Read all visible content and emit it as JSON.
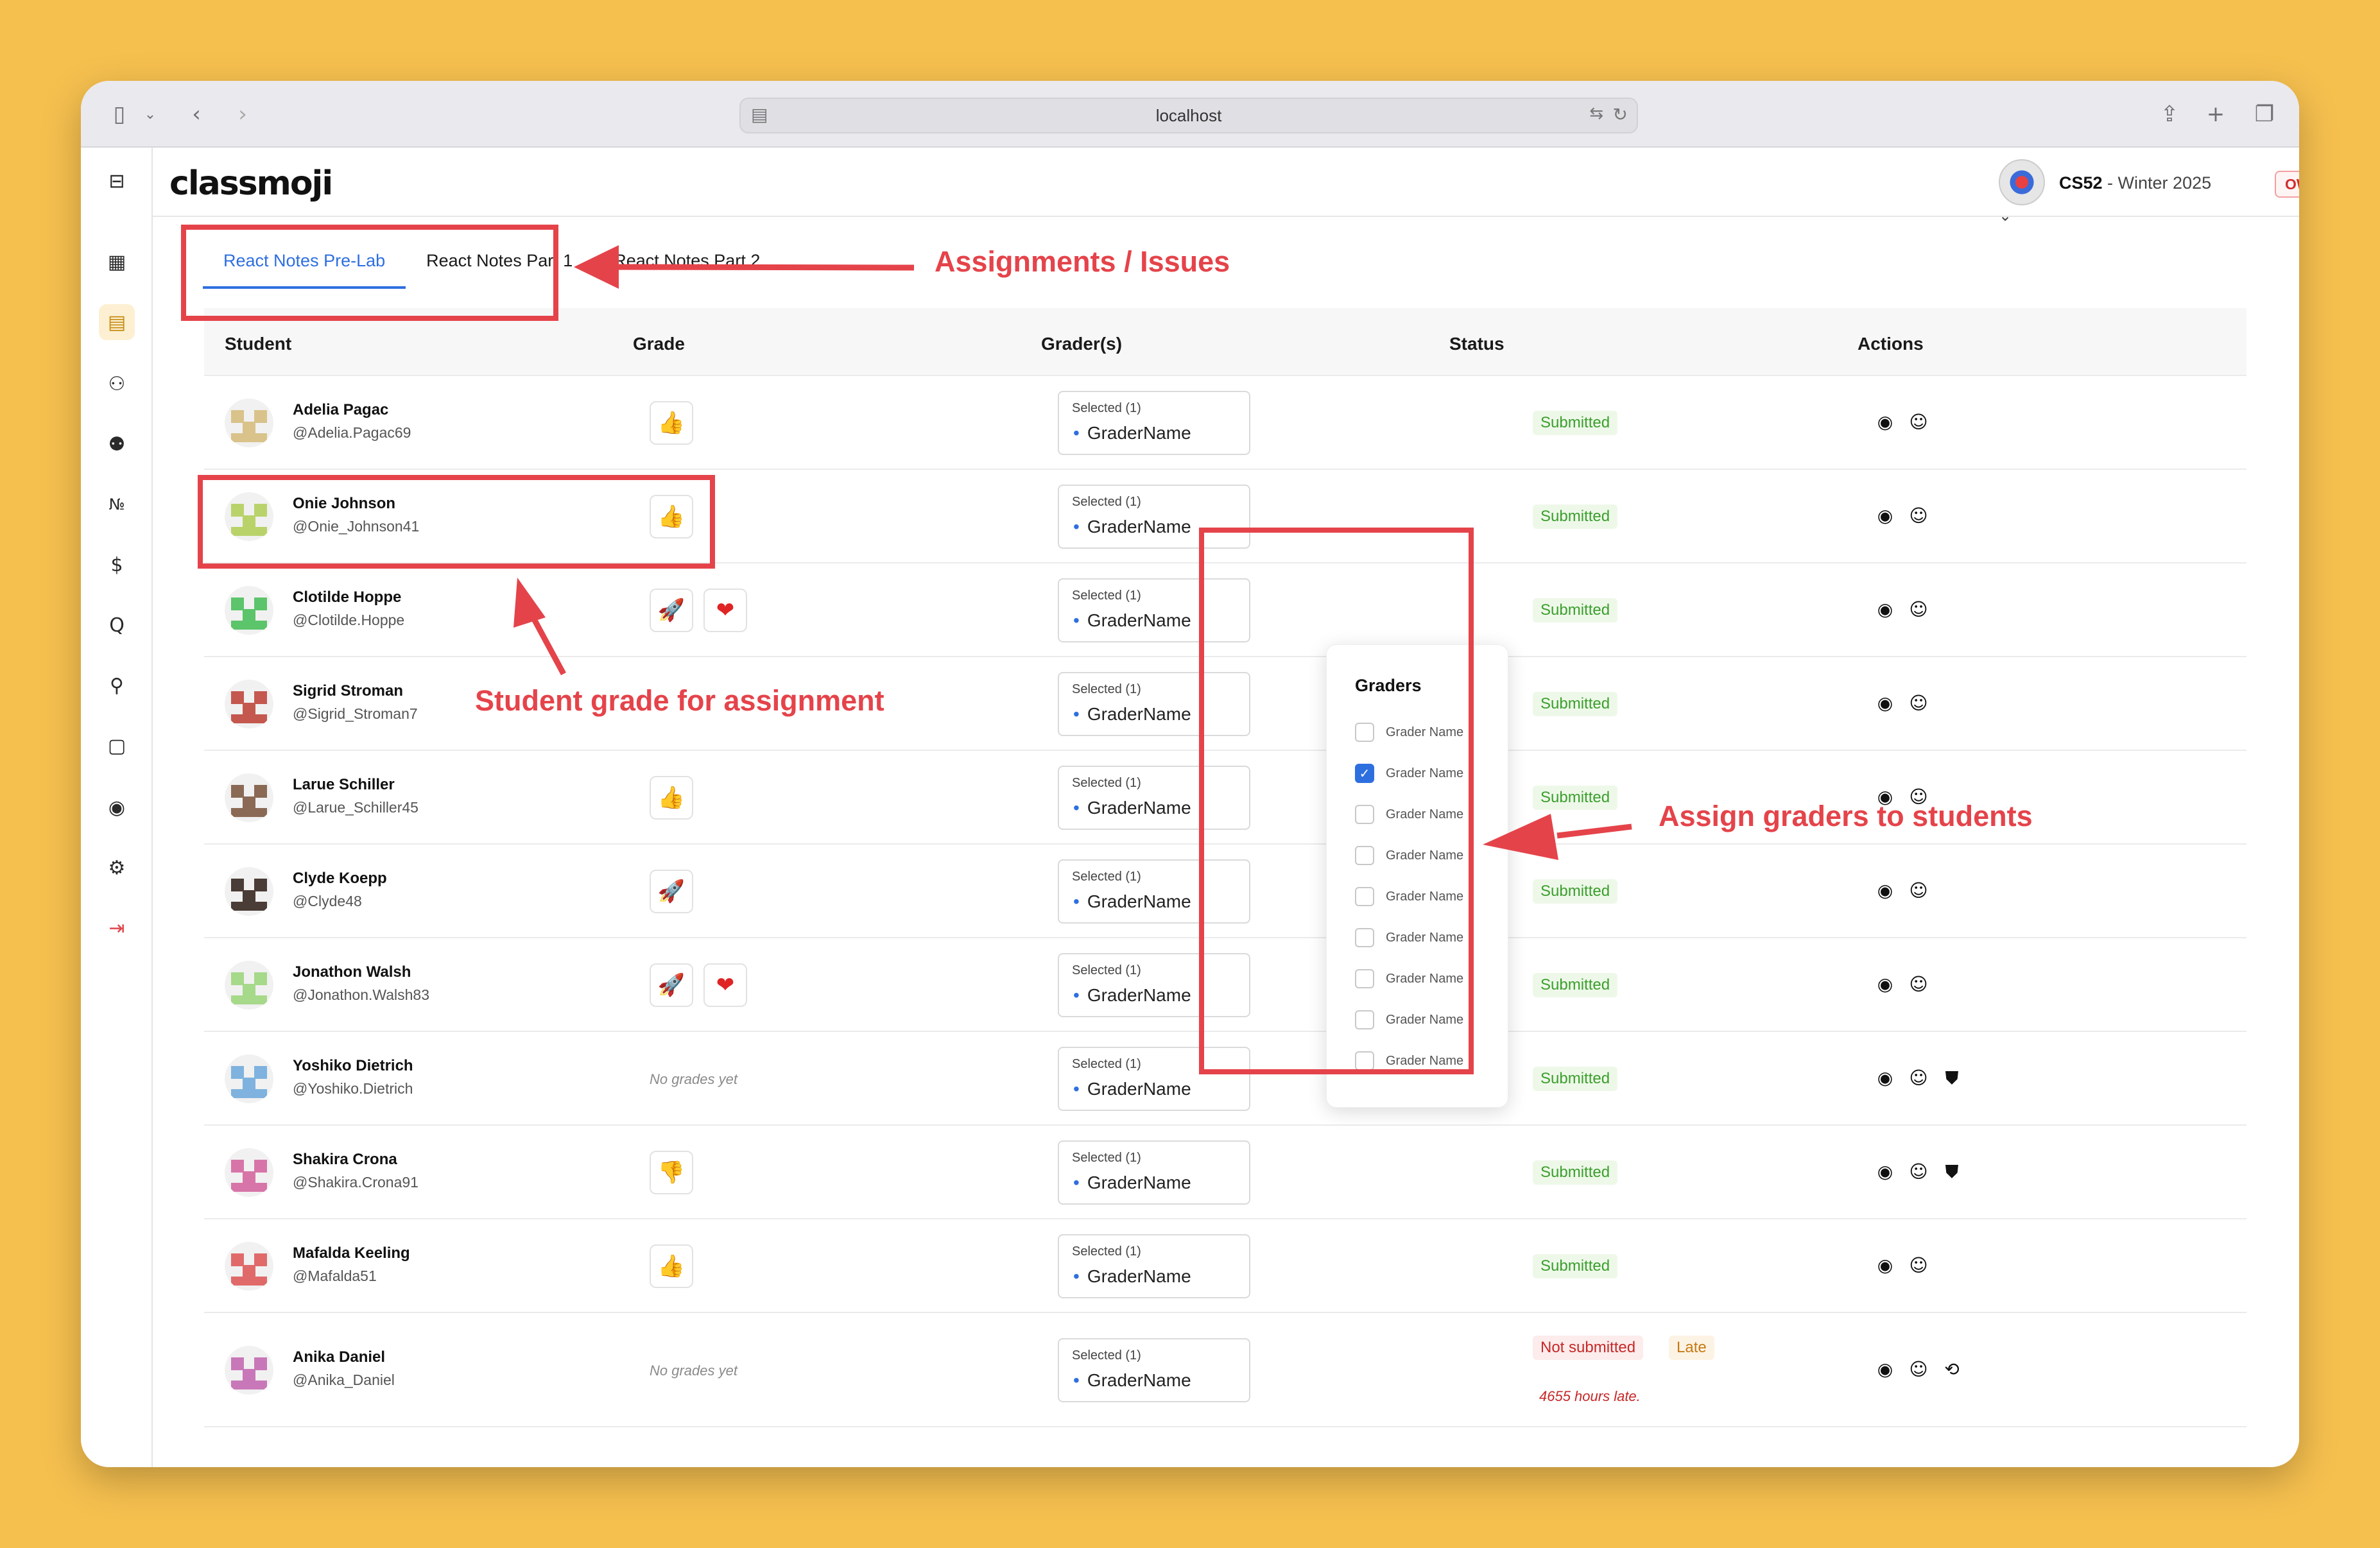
{
  "browser": {
    "url": "localhost"
  },
  "header": {
    "logo": "classmoji",
    "course_code": "CS52",
    "course_term": " - Winter 2025",
    "role_badge": "OWNER"
  },
  "tabs": [
    {
      "label": "React Notes Pre-Lab",
      "active": true
    },
    {
      "label": "React Notes Part 1",
      "active": false
    },
    {
      "label": "React Notes Part 2",
      "active": false
    }
  ],
  "table": {
    "columns": [
      "Student",
      "Grade",
      "Grader(s)",
      "Status",
      "Actions"
    ],
    "rows": [
      {
        "name": "Adelia Pagac",
        "handle": "@Adelia.Pagac69",
        "grades": [
          "thumbs-up"
        ],
        "grader_selected": "Selected (1)",
        "grader_name": "GraderName",
        "status": "Submitted"
      },
      {
        "name": "Onie Johnson",
        "handle": "@Onie_Johnson41",
        "grades": [
          "thumbs-up"
        ],
        "grader_selected": "Selected (1)",
        "grader_name": "GraderName",
        "status": "Submitted"
      },
      {
        "name": "Clotilde Hoppe",
        "handle": "@Clotilde.Hoppe",
        "grades": [
          "rocket",
          "heart"
        ],
        "grader_selected": "Selected (1)",
        "grader_name": "GraderName",
        "status": "Submitted"
      },
      {
        "name": "Sigrid Stroman",
        "handle": "@Sigrid_Stroman7",
        "grades": [],
        "grader_selected": "Selected (1)",
        "grader_name": "GraderName",
        "status": "Submitted"
      },
      {
        "name": "Larue Schiller",
        "handle": "@Larue_Schiller45",
        "grades": [
          "thumbs-up"
        ],
        "grader_selected": "Selected (1)",
        "grader_name": "GraderName",
        "status": "Submitted"
      },
      {
        "name": "Clyde Koepp",
        "handle": "@Clyde48",
        "grades": [
          "rocket"
        ],
        "grader_selected": "Selected (1)",
        "grader_name": "GraderName",
        "status": "Submitted"
      },
      {
        "name": "Jonathon Walsh",
        "handle": "@Jonathon.Walsh83",
        "grades": [
          "rocket",
          "heart"
        ],
        "grader_selected": "Selected (1)",
        "grader_name": "GraderName",
        "status": "Submitted"
      },
      {
        "name": "Yoshiko Dietrich",
        "handle": "@Yoshiko.Dietrich",
        "no_grades": "No grades yet",
        "grader_selected": "Selected (1)",
        "grader_name": "GraderName",
        "status": "Submitted"
      },
      {
        "name": "Shakira Crona",
        "handle": "@Shakira.Crona91",
        "grades": [
          "thumbs-down"
        ],
        "grader_selected": "Selected (1)",
        "grader_name": "GraderName",
        "status": "Submitted"
      },
      {
        "name": "Mafalda Keeling",
        "handle": "@Mafalda51",
        "grades": [
          "thumbs-up"
        ],
        "grader_selected": "Selected (1)",
        "grader_name": "GraderName",
        "status": "Submitted"
      },
      {
        "name": "Anika Daniel",
        "handle": "@Anika_Daniel",
        "no_grades": "No grades yet",
        "grader_selected": "Selected (1)",
        "grader_name": "GraderName",
        "status": "Not submitted",
        "status_extra": "Late",
        "late_text": "4655 hours late."
      }
    ]
  },
  "graders_popover": {
    "title": "Graders",
    "items": [
      {
        "label": "Grader Name",
        "checked": false
      },
      {
        "label": "Grader Name",
        "checked": true
      },
      {
        "label": "Grader Name",
        "checked": false
      },
      {
        "label": "Grader Name",
        "checked": false
      },
      {
        "label": "Grader Name",
        "checked": false
      },
      {
        "label": "Grader Name",
        "checked": false
      },
      {
        "label": "Grader Name",
        "checked": false
      },
      {
        "label": "Grader Name",
        "checked": false
      },
      {
        "label": "Grader Name",
        "checked": false
      }
    ]
  },
  "annotations": {
    "assignments": "Assignments / Issues",
    "student_grade": "Student grade for assignment",
    "assign_graders": "Assign graders to students"
  },
  "colors": {
    "background": "#F6C04F",
    "accent_blue": "#2e6fe0",
    "annotation_red": "#E5434A",
    "submitted_green": "#3a9f2c"
  }
}
